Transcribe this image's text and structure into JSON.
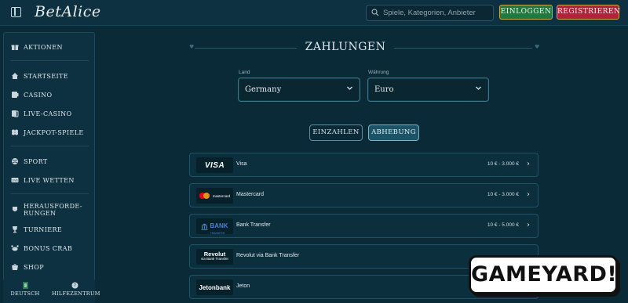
{
  "header": {
    "logo": "BetAlice",
    "search_placeholder": "Spiele, Kategorien, Anbieter",
    "login_label": "EINLOGGEN",
    "register_label": "REGISTRIEREN"
  },
  "sidebar": {
    "items": [
      {
        "label": "AKTIONEN",
        "icon": "gift-icon"
      },
      {
        "label": "STARTSEITE",
        "icon": "home-icon"
      },
      {
        "label": "CASINO",
        "icon": "casino-icon"
      },
      {
        "label": "LIVE-CASINO",
        "icon": "cards-icon"
      },
      {
        "label": "JACKPOT-SPIELE",
        "icon": "clover-icon"
      },
      {
        "label": "SPORT",
        "icon": "ball-icon"
      },
      {
        "label": "LIVE WETTEN",
        "icon": "live-icon"
      },
      {
        "label": "HERAUSFORDE-",
        "label2": "RUNGEN",
        "icon": "challenge-icon"
      },
      {
        "label": "TURNIERE",
        "icon": "trophy-icon"
      },
      {
        "label": "BONUS CRAB",
        "icon": "crab-icon"
      },
      {
        "label": "SHOP",
        "icon": "shop-icon"
      }
    ],
    "bottom": [
      {
        "label": "DEUTSCH",
        "icon": "flag-icon"
      },
      {
        "label": "HILFEZENTRUM",
        "icon": "help-icon"
      }
    ]
  },
  "main": {
    "title": "ZAHLUNGEN",
    "country": {
      "label": "Land",
      "value": "Germany"
    },
    "currency": {
      "label": "Währung",
      "value": "Euro"
    },
    "tabs": [
      {
        "label": "EINZAHLEN",
        "active": false
      },
      {
        "label": "ABHEBUNG",
        "active": true
      }
    ],
    "methods": [
      {
        "name": "Visa",
        "range": "10 € - 3.000 €",
        "logo": "VISA"
      },
      {
        "name": "Mastercard",
        "range": "10 € - 3.000 €",
        "logo": "mastercard"
      },
      {
        "name": "Bank Transfer",
        "range": "10 € - 5.000 €",
        "logo": "BANK",
        "logo_sub": "TRANSFER"
      },
      {
        "name": "Revolut via Bank Transfer",
        "range": "",
        "logo": "Revolut",
        "logo_sub": "via Bank Transfer"
      },
      {
        "name": "Jeton",
        "range": "",
        "logo": "Jetonbank"
      }
    ]
  },
  "watermark": "GAMEYARD!",
  "colors": {
    "background": "#0b2a38",
    "login": "#1e7a3e",
    "register": "#b0233b",
    "accent_gold": "#c9a54a"
  }
}
